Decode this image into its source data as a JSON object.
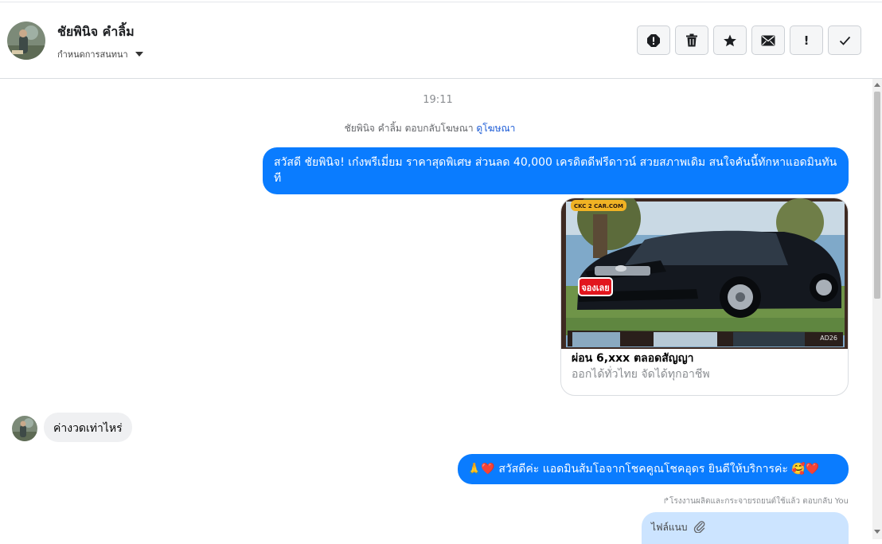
{
  "header": {
    "contact_name": "ชัยพินิจ คำลิ้ม",
    "settings_label": "กำหนดการสนทนา",
    "actions": [
      {
        "name": "report-icon"
      },
      {
        "name": "trash-icon"
      },
      {
        "name": "star-icon"
      },
      {
        "name": "envelope-icon"
      },
      {
        "name": "exclamation-icon",
        "label": "!"
      },
      {
        "name": "checkmark-icon"
      }
    ]
  },
  "thread": {
    "timestamp": "19:11",
    "ad_reply_text": "ชัยพินิจ คำลิ้ม ตอบกลับโฆษณา",
    "ad_link": "ดูโฆษณา",
    "message_1": "สวัสดี ชัยพินิจ! เก๋งพรีเมี่ยม ราคาสุดพิเศษ ส่วนลด 40,000 เครดิตดีฟรีดาวน์ สวยสภาพเดิม สนใจคันนี้ทักหาแอดมินทันที",
    "ad_card": {
      "badge": "CKC 2 CAR.COM",
      "sticker": "จองเลย",
      "plate": "AD26",
      "title": "ผ่อน 6,xxx ตลอดสัญญา",
      "subtitle": "ออกได้ทั่วไทย จัดได้ทุกอาชีพ"
    },
    "incoming_message": "ค่างวดเท่าไหร่",
    "message_3": "🙏❤️ สวัสดีค่ะ แอดมินส้มโอจากโชคคูณโชคอุดร ยินดีให้บริการค่ะ 🥰❤️",
    "sent_note": "↱โรงงานผลิตและกระจายรถยนต์ใช้แล้ว ตอบกลับ You",
    "attachment_label": "ไฟล์แนบ"
  },
  "colors": {
    "outgoing_bubble": "#0a7cff",
    "incoming_bubble": "#eff0f2",
    "attachment_bubble": "#cce4ff",
    "link": "#1b5bd6"
  }
}
